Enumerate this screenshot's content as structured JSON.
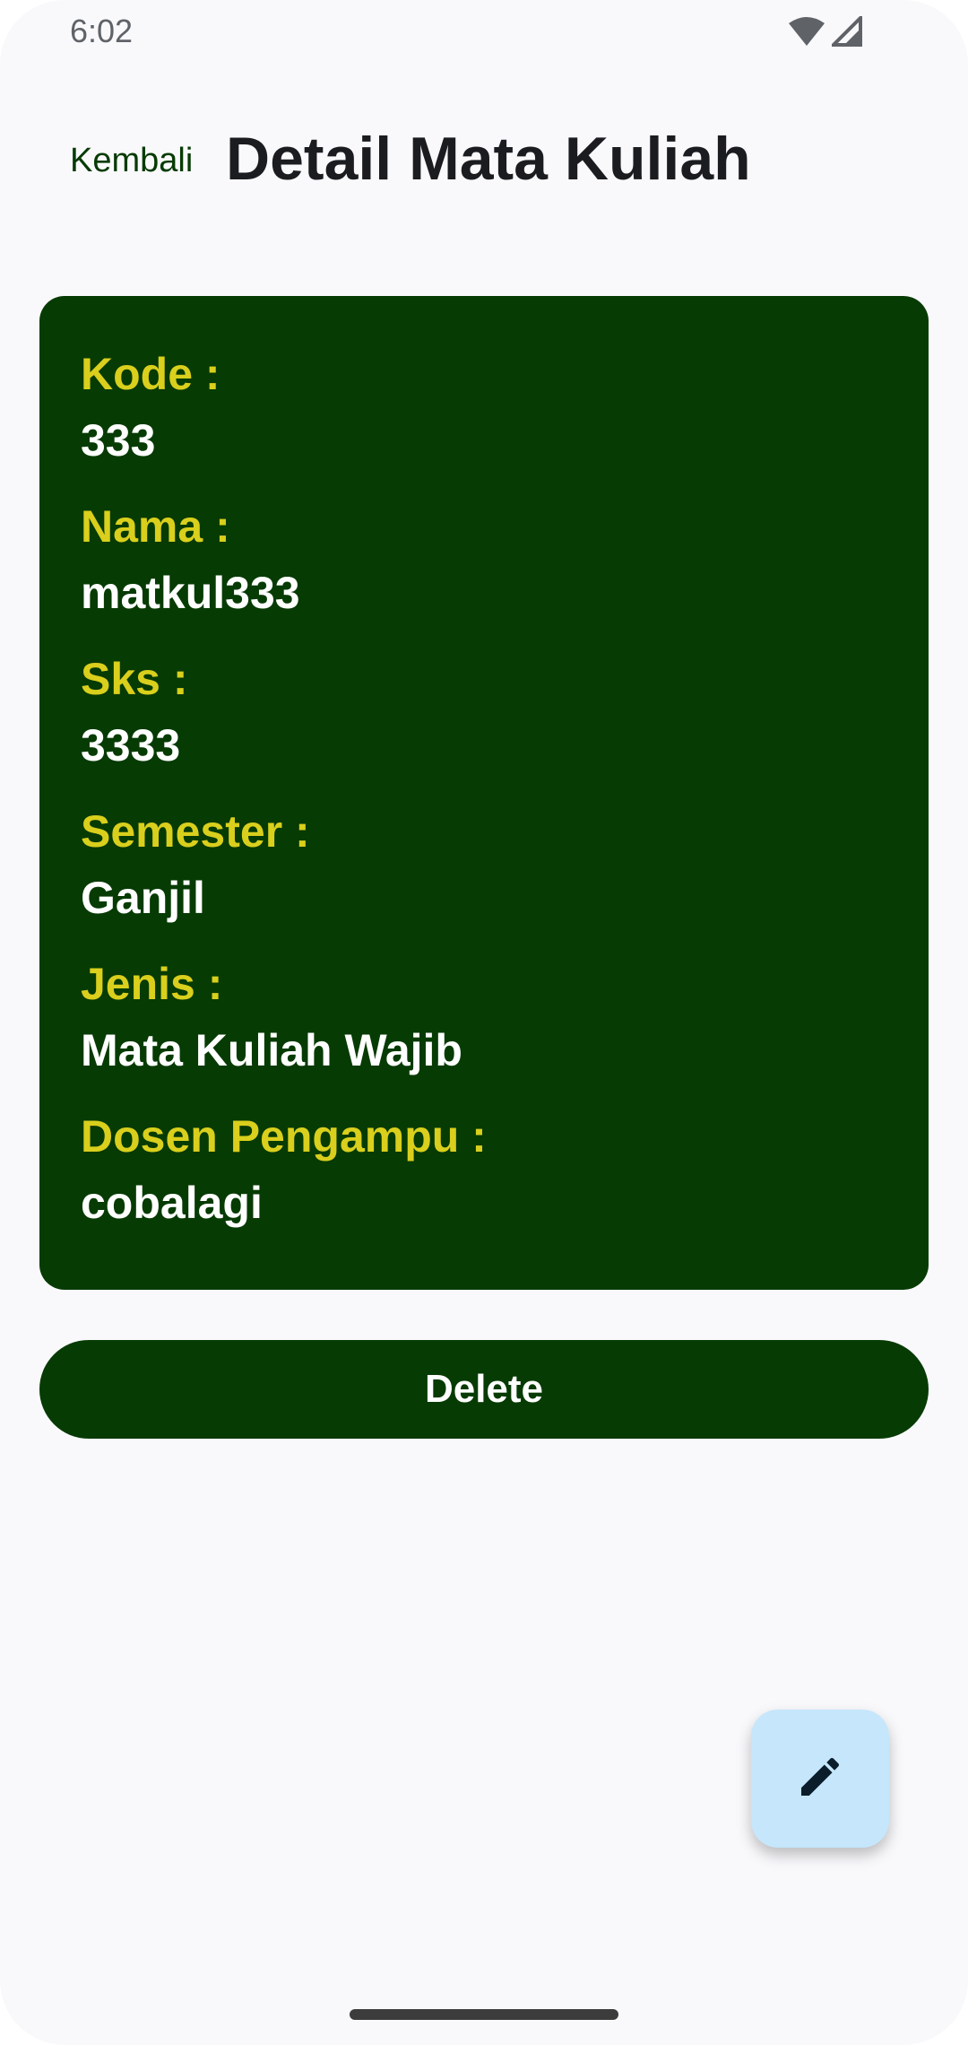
{
  "status_bar": {
    "time": "6:02",
    "icons": [
      "wifi-icon",
      "cellular-signal-icon"
    ]
  },
  "top_bar": {
    "back_label": "Kembali",
    "title": "Detail Mata Kuliah"
  },
  "detail": {
    "fields": [
      {
        "label": "Kode :",
        "value": "333"
      },
      {
        "label": "Nama :",
        "value": "matkul333"
      },
      {
        "label": "Sks :",
        "value": "3333"
      },
      {
        "label": "Semester :",
        "value": "Ganjil"
      },
      {
        "label": "Jenis :",
        "value": "Mata Kuliah Wajib"
      },
      {
        "label": "Dosen Pengampu :",
        "value": "cobalagi"
      }
    ]
  },
  "actions": {
    "delete_label": "Delete",
    "fab_icon": "edit-pencil-icon"
  },
  "colors": {
    "primary": "#073b04",
    "label_accent": "#d9cf1c",
    "fab_background": "#c5e6fb",
    "screen_background": "#f9f9fc"
  }
}
